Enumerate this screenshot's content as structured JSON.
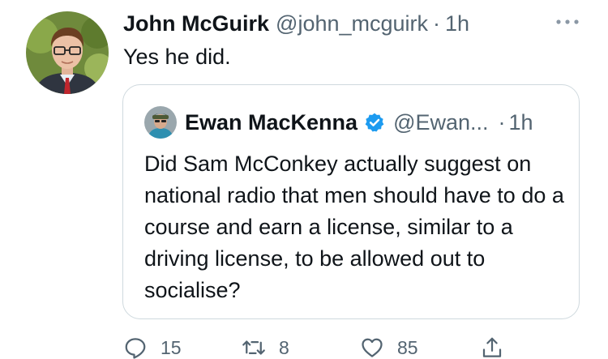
{
  "tweet": {
    "author": {
      "display_name": "John McGuirk",
      "handle": "@john_mcguirk",
      "avatar": "profile-photo"
    },
    "separator": "·",
    "time": "1h",
    "text": "Yes he did.",
    "more_icon": "more-horizontal-icon"
  },
  "quote": {
    "author": {
      "display_name": "Ewan MacKenna",
      "handle": "@Ewan...",
      "verified_icon": "verified-badge-icon",
      "avatar": "profile-photo"
    },
    "separator": "·",
    "time": "1h",
    "text": "Did  Sam McConkey actually suggest on national radio that men should have to do a course and earn a license, similar to a driving license, to be allowed out to socialise?"
  },
  "actions": {
    "reply": {
      "icon": "reply-icon",
      "count": "15"
    },
    "retweet": {
      "icon": "retweet-icon",
      "count": "8"
    },
    "like": {
      "icon": "heart-icon",
      "count": "85"
    },
    "share": {
      "icon": "share-icon"
    }
  },
  "colors": {
    "text_primary": "#0f1419",
    "text_secondary": "#536471",
    "border": "#cfd9de",
    "verified_blue": "#1d9bf0"
  }
}
